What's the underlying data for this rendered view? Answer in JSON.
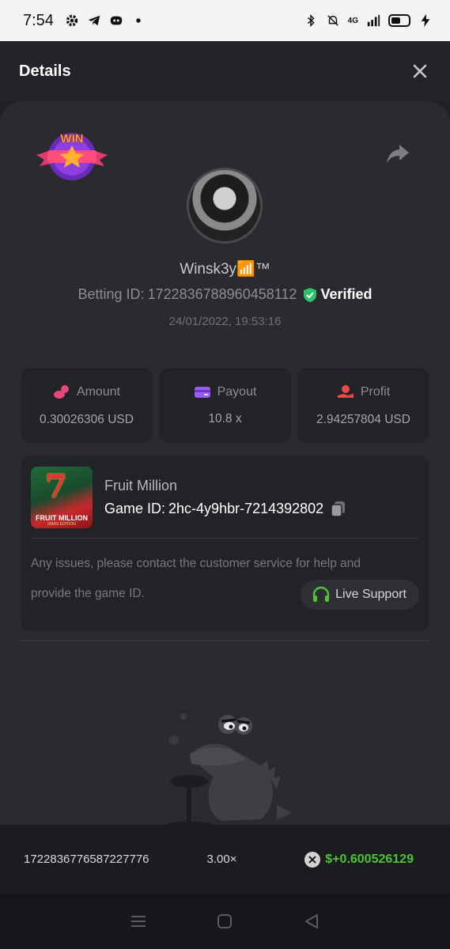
{
  "statusbar": {
    "time": "7:54",
    "network": "4G"
  },
  "header": {
    "title": "Details"
  },
  "profile": {
    "username": "Winsk3y📶™",
    "betting_id_label": "Betting ID:",
    "betting_id": "1722836788960458112",
    "verified_label": "Verified",
    "datetime": "24/01/2022, 19:53:16",
    "badge_text": "WIN"
  },
  "stats": [
    {
      "label": "Amount",
      "value": "0.30026306 USD",
      "icon": "coins-icon",
      "color": "#e8457a"
    },
    {
      "label": "Payout",
      "value": "10.8 x",
      "icon": "card-icon",
      "color": "#9b5cf5"
    },
    {
      "label": "Profit",
      "value": "2.94257804 USD",
      "icon": "hand-coin-icon",
      "color": "#e84a4a"
    }
  ],
  "game": {
    "name": "Fruit Million",
    "id_label": "Game ID:",
    "id": "2hc-4y9hbr-7214392802",
    "thumb_title": "FRUIT MILLION",
    "thumb_subtitle": "XMAS EDITION",
    "thumb_symbol": "7",
    "notice_line1": "Any issues, please contact the customer service for help and",
    "notice_line2": "provide the game ID.",
    "support_label": "Live Support"
  },
  "bottom_bet": {
    "id": "1722836776587227776",
    "multiplier": "3.00×",
    "profit": "$+0.600526129"
  },
  "colors": {
    "accent_green": "#4fc236",
    "verified_green": "#2ec26a",
    "background": "#1f2023"
  }
}
